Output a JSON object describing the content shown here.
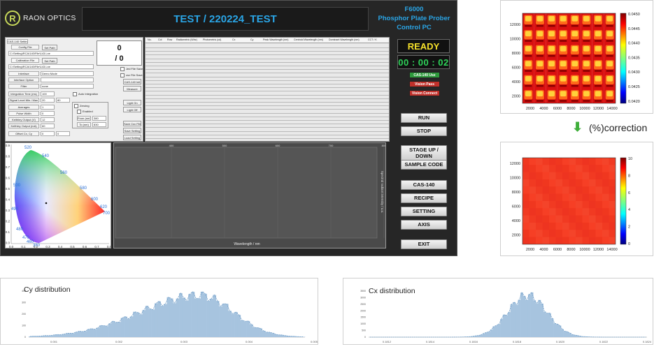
{
  "app": {
    "logo_mark": "R",
    "logo_text": "RAON OPTICS",
    "title": "TEST / 220224_TEST",
    "brand_line1": "F6000",
    "brand_line2": "Phosphor Plate Prober",
    "brand_line3": "Control PC",
    "status": "READY",
    "timer": "00 : 00 : 02",
    "counter_top": "0",
    "counter_bottom": "/ 0",
    "status_buttons": [
      "CAS-140 Use",
      "Vision Pass",
      "Vision Connect"
    ],
    "side_buttons": [
      "RUN",
      "STOP",
      "STAGE UP / DOWN",
      "SAMPLE CODE",
      "CAS-140",
      "RECIPE",
      "SETTING",
      "AXIS",
      "EXIT"
    ],
    "colors": {
      "accent": "#2aa5e6",
      "ready": "#f5e02a",
      "timer": "#2fd35a",
      "cas_use": "#2e9a3c",
      "vision": "#c0302a"
    }
  },
  "settings": {
    "group_label": "CAS-140 Setting",
    "config_file_label": "Config File",
    "config_path": "C:\\Setting\\RCA\\140\\File\\143.Lxe",
    "calib_file_label": "Calibration File",
    "calib_path": "C:\\Setting\\RCA\\140\\File\\143.Lxe",
    "set_path": "Set Path",
    "interface_label": "Interface",
    "interface_value": "Demo Mode",
    "interface_option_label": "Interface Option",
    "filter_label": "Filter",
    "filter_value": "none",
    "integration_label": "Integration Time (ms)",
    "integration_value": "100",
    "auto_integration": "Auto Integration",
    "signal_label": "Signal Level Min / Max",
    "signal_min": "20",
    "signal_max": "80",
    "averages_label": "Averages",
    "averages_value": "1",
    "pulse_label": "Pulse Width",
    "pulse_value": "0",
    "keithley_in_label": "Keithley Output (V)",
    "keithley_in_value": "12",
    "keithley_out_label": "Keithley Output (mA)",
    "keithley_out_value": "60",
    "offset_label": "Offset Cx, Cy",
    "offset_x": "0",
    "offset_y": "0",
    "zero_box_label": "Zeroing",
    "enabled_label": "Enabled",
    "from_label": "From (nm)",
    "from_value": "380",
    "to_label": "To (nm)",
    "to_value": "830",
    "right_buttons": [
      "Jed File Save",
      "csv File Save",
      "CAS-140 Init",
      "Measure",
      "Light On",
      "Light Off",
      "Save Csv File",
      "Save Setting",
      "Load Setting"
    ]
  },
  "table": {
    "headers": [
      "No.",
      "Col",
      "Row",
      "Radiometric (W/sr)",
      "Photometric (cd)",
      "Cx",
      "Cy",
      "Peak Wavelength (nm)",
      "Centroid Wavelength (nm)",
      "Dominant Wavelength (nm)",
      "CCT / K"
    ]
  },
  "cie": {
    "wavelengths": [
      "520",
      "540",
      "560",
      "580",
      "600",
      "620",
      "700",
      "500",
      "490",
      "480",
      "470",
      "460",
      "380"
    ],
    "y_ticks": [
      "0.9",
      "0.8",
      "0.7",
      "0.6",
      "0.5",
      "0.4",
      "0.3",
      "0.2",
      "0.1",
      "0.0"
    ],
    "x_ticks": [
      "0.0",
      "0.1",
      "0.2",
      "0.3",
      "0.4",
      "0.5",
      "0.6",
      "0.7",
      "0.8"
    ]
  },
  "spectrum": {
    "x_ticks": [
      "400",
      "500",
      "600",
      "700",
      "800"
    ],
    "x_label": "Wavelength / nm",
    "y_label": "Spectral radiant intensity / a.u."
  },
  "heatmap_before": {
    "x_ticks": [
      "2000",
      "4000",
      "6000",
      "8000",
      "10000",
      "12000",
      "14000"
    ],
    "y_ticks": [
      "12000",
      "10000",
      "8000",
      "6000",
      "4000",
      "2000"
    ],
    "colorbar_ticks": [
      "0.0450",
      "0.0445",
      "0.0440",
      "0.0435",
      "0.0430",
      "0.0425",
      "0.0420"
    ]
  },
  "correction_label": "(%)correction",
  "heatmap_after": {
    "x_ticks": [
      "2000",
      "4000",
      "6000",
      "8000",
      "10000",
      "12000",
      "14000"
    ],
    "y_ticks": [
      "12000",
      "10000",
      "8000",
      "6000",
      "4000",
      "2000"
    ],
    "colorbar_ticks": [
      "10",
      "8",
      "6",
      "4",
      "2",
      "0"
    ]
  },
  "hist_cy": {
    "title": "Cy distribution",
    "x_ticks": [
      "0.001",
      "0.002",
      "0.003",
      "0.004",
      "0.005"
    ],
    "y_ticks": [
      "400",
      "300",
      "200",
      "100",
      "0"
    ]
  },
  "hist_cx": {
    "title": "Cx distribution",
    "x_ticks": [
      "0.1812",
      "0.1814",
      "0.1816",
      "0.1818",
      "0.1820",
      "0.1822",
      "0.1824"
    ],
    "y_ticks": [
      "3500",
      "3000",
      "2500",
      "2000",
      "1500",
      "1000",
      "500",
      "0"
    ]
  }
}
